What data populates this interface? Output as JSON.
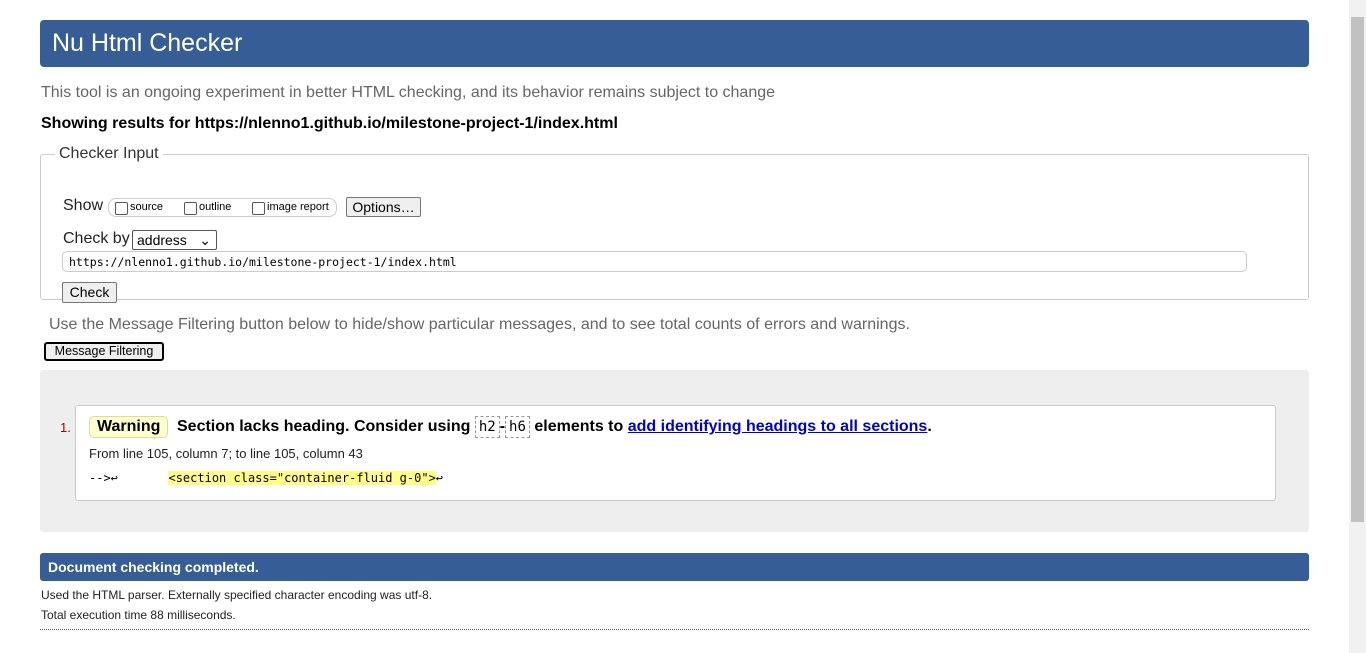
{
  "header": {
    "title": "Nu Html Checker"
  },
  "intro": "This tool is an ongoing experiment in better HTML checking, and its behavior remains subject to change",
  "showing": "Showing results for https://nlenno1.github.io/milestone-project-1/index.html",
  "checker": {
    "legend": "Checker Input",
    "show_label": "Show",
    "options": [
      "source",
      "outline",
      "image report"
    ],
    "options_button": "Options…",
    "check_by_label": "Check by",
    "check_by_value": "address",
    "url": "https://nlenno1.github.io/milestone-project-1/index.html",
    "check_button": "Check"
  },
  "filter": {
    "text": "Use the Message Filtering button below to hide/show particular messages, and to see total counts of errors and warnings.",
    "button": "Message Filtering"
  },
  "messages": [
    {
      "num": "1.",
      "type": "Warning",
      "text_a": "Section lacks heading. Consider using",
      "code1": "h2",
      "dash": "-",
      "code2": "h6",
      "text_b": "elements to",
      "link": "add identifying headings to all sections",
      "end": ".",
      "location": "From line 105, column 7; to line 105, column 43",
      "extract_pre": "-->↩       ",
      "extract_hl": "<section class=\"container-fluid g-0\">",
      "extract_post": "↩"
    }
  ],
  "footer": {
    "title": "Document checking completed.",
    "parser": "Used the HTML parser. Externally specified character encoding was utf-8.",
    "time": "Total execution time 88 milliseconds."
  }
}
